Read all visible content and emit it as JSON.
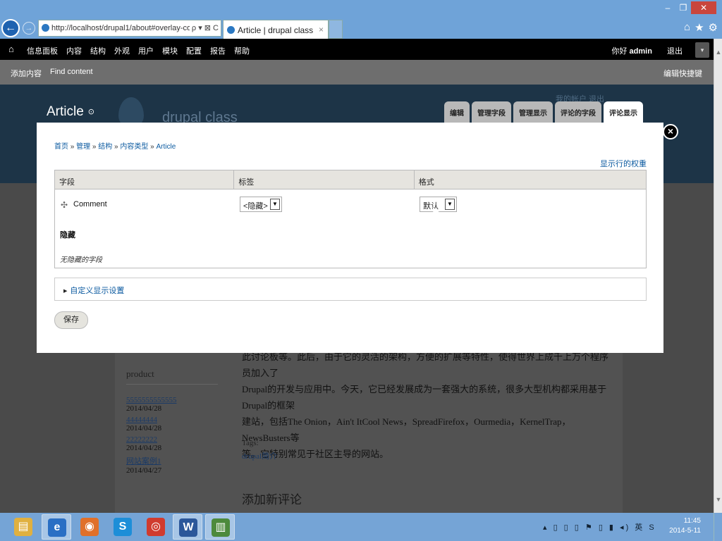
{
  "browser": {
    "address_url": "http://localhost/drupal1/about#overlay-cor",
    "address_tools": "ρ ▾ ⊠ C",
    "tab_title": "Article | drupal class",
    "tab_close": "×",
    "right_icons": [
      "⌂",
      "★",
      "⚙"
    ],
    "window_controls": [
      "–",
      "❐",
      "✕"
    ]
  },
  "toolbar": {
    "home": "⌂",
    "menu": [
      "信息面板",
      "内容",
      "结构",
      "外观",
      "用户",
      "模块",
      "配置",
      "报告",
      "帮助"
    ],
    "greeting": "你好",
    "username": "admin",
    "logout": "退出",
    "toggle": "▾"
  },
  "shortcuts": {
    "items": [
      "添加内容",
      "Find content"
    ],
    "edit": "编辑快捷键"
  },
  "header": {
    "title": "Article",
    "site_name": "drupal class",
    "user_links": "我的帐户  退出",
    "tabs": [
      "编辑",
      "管理字段",
      "管理显示",
      "评论的字段",
      "评论显示"
    ],
    "active_tab": 4
  },
  "modal": {
    "breadcrumb": [
      "首页",
      "管理",
      "结构",
      "内容类型",
      "Article"
    ],
    "breadcrumb_sep": " » ",
    "row_weights_link": "显示行的权重",
    "columns": [
      "字段",
      "标签",
      "格式"
    ],
    "rows": [
      {
        "field": "Comment",
        "label": "<隐藏>",
        "format": "默认"
      }
    ],
    "hidden_heading": "隐藏",
    "hidden_empty": "无隐藏的字段",
    "custom_display": "自定义显示设置",
    "save": "保存",
    "close": "×"
  },
  "page_behind": {
    "sidebar_title": "product",
    "sidebar_items": [
      {
        "title": "5555555555555",
        "date": "2014/04/28"
      },
      {
        "title": "44444444",
        "date": "2014/04/28"
      },
      {
        "title": "22222222",
        "date": "2014/04/28"
      },
      {
        "title": "网站案例1",
        "date": "2014/04/27"
      }
    ],
    "body_lines": [
      "此讨论板等。此后，由于它的灵活的架构，方便的扩展等特性，使得世界上成千上万个程序员加入了",
      "Drupal的开发与应用中。今天，它已经发展成为一套强大的系统，很多大型机构都采用基于Drupal的框架",
      "建站，包括The Onion，Ain't ItCool News，SpreadFirefox，Ourmedia，KernelTrap，NewsBusters等",
      "等。它特别常见于社区主导的网站。"
    ],
    "tags_label": "Tags:",
    "tag": "drupal简介",
    "add_comment": "添加新评论"
  },
  "taskbar": {
    "apps": [
      {
        "name": "file-explorer",
        "glyph": "▤",
        "color": "#e0b040"
      },
      {
        "name": "internet-explorer",
        "glyph": "e",
        "color": "#2a6fc4"
      },
      {
        "name": "firefox",
        "glyph": "◉",
        "color": "#e0702a"
      },
      {
        "name": "skype",
        "glyph": "S",
        "color": "#1d8ed8"
      },
      {
        "name": "chrome",
        "glyph": "◎",
        "color": "#d03b2f"
      },
      {
        "name": "word",
        "glyph": "W",
        "color": "#2b579a"
      },
      {
        "name": "project",
        "glyph": "▥",
        "color": "#4d8a3c"
      }
    ],
    "active_app": 1,
    "tray": "▴ ▯ ▯ ▯ ⚑ ▯ ▮ ◂) 英 S",
    "time": "11:45",
    "date": "2014-5-11"
  }
}
